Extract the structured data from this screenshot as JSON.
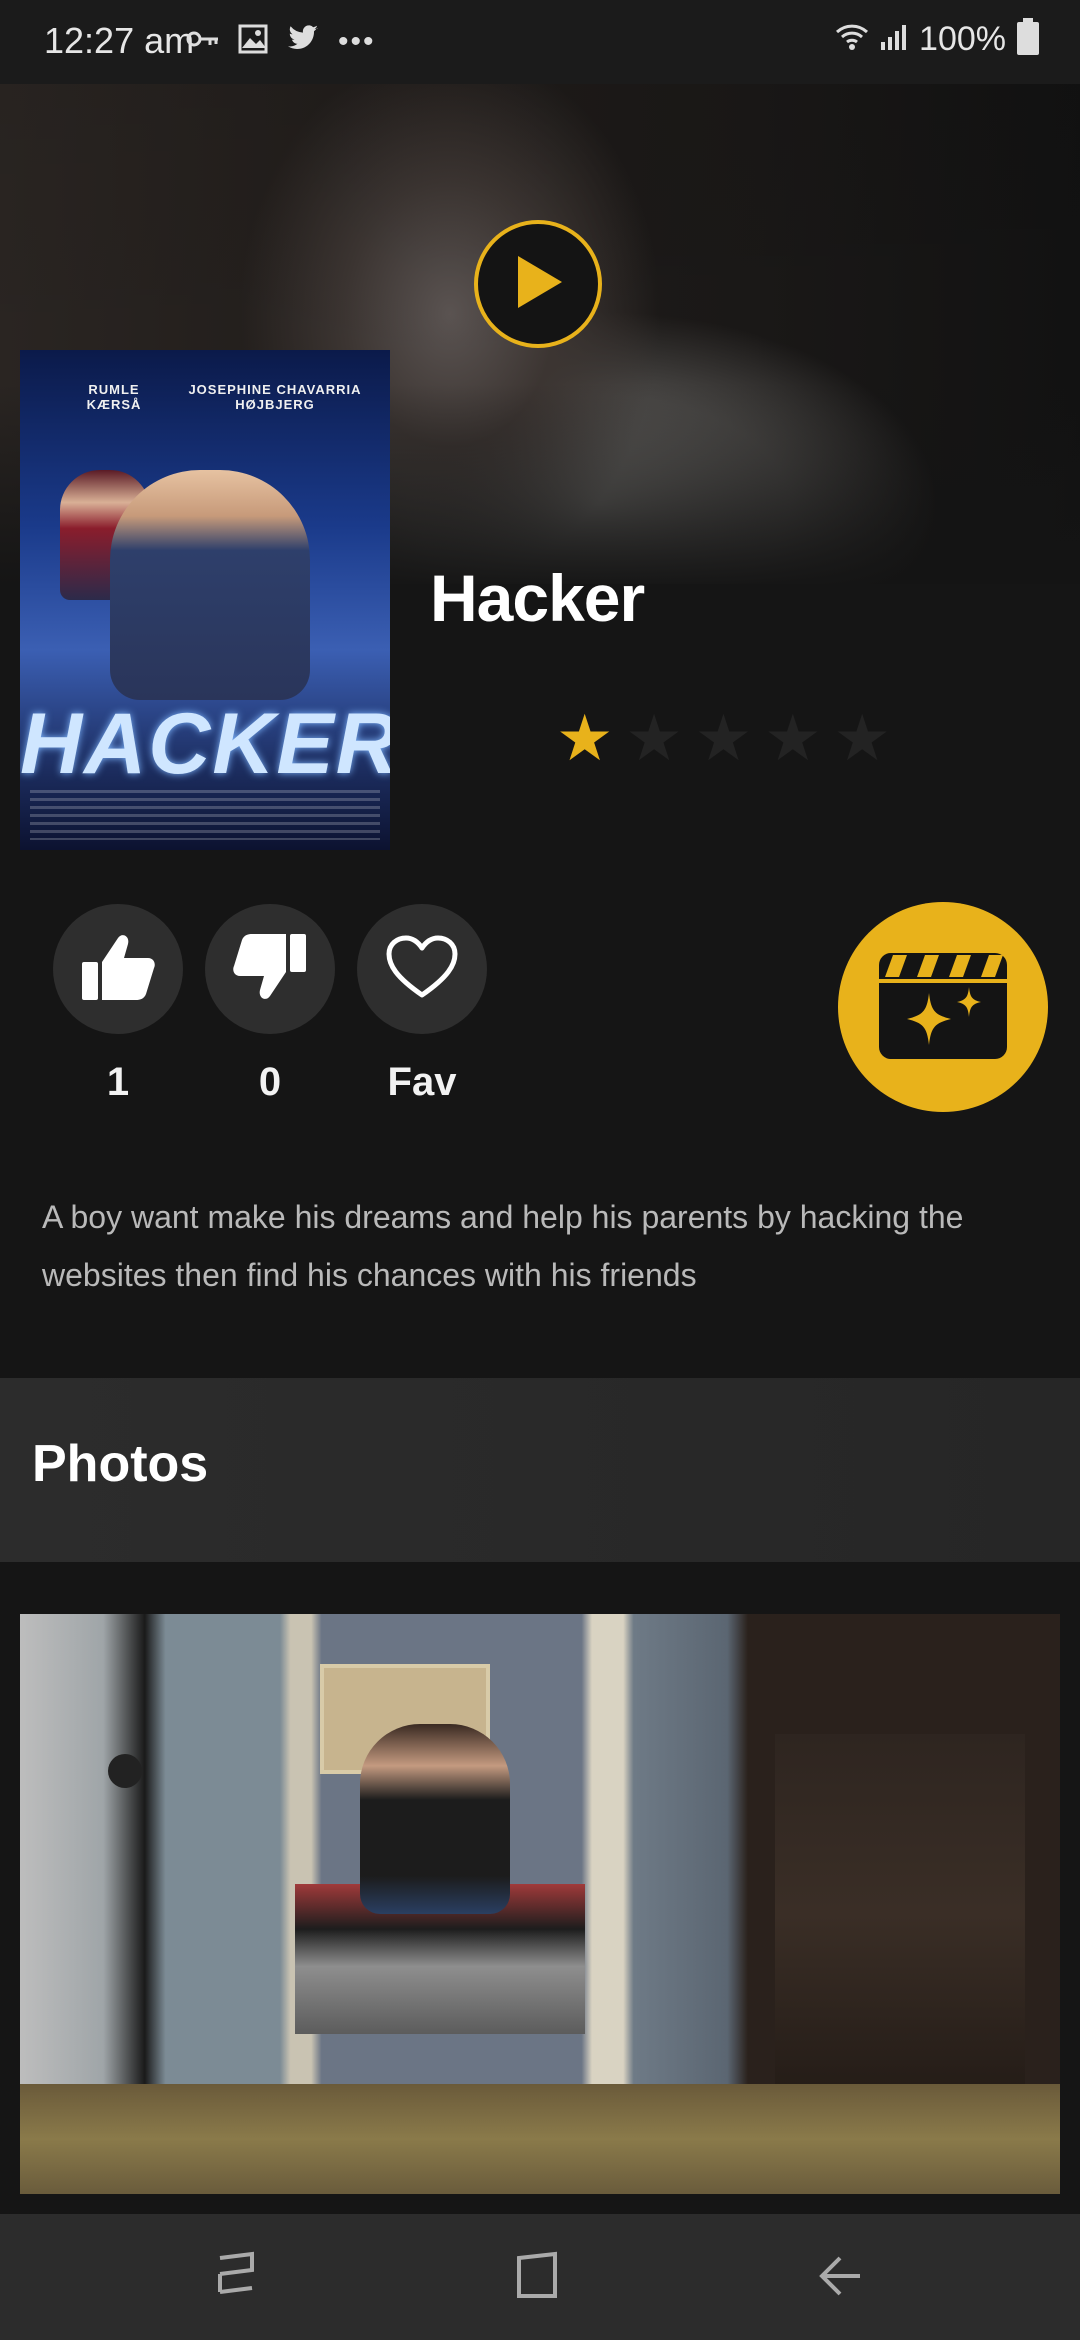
{
  "status_bar": {
    "time": "12:27 am",
    "battery_percent": "100%",
    "notification_icons": [
      "key-icon",
      "image-icon",
      "twitter-icon",
      "more-dots-icon"
    ],
    "system_icons": [
      "wifi-icon",
      "signal-icon",
      "battery-icon"
    ]
  },
  "movie": {
    "title": "Hacker",
    "rating": {
      "value": 1,
      "max": 5
    },
    "description": "A boy want make his dreams and help his parents by hacking the websites then find his chances with his friends",
    "poster": {
      "credit_left": "RUMLE\nKÆRSÅ",
      "credit_right": "JOSEPHINE CHAVARRIA\nHØJBJERG",
      "title": "HACKER"
    }
  },
  "actions": {
    "likes": "1",
    "dislikes": "0",
    "fav_label": "Fav"
  },
  "photos_section": {
    "title": "Photos"
  },
  "colors": {
    "accent": "#e8b21b",
    "background": "#151515",
    "action_circle": "#2e2e2e",
    "description_text": "#b9b9b9"
  }
}
